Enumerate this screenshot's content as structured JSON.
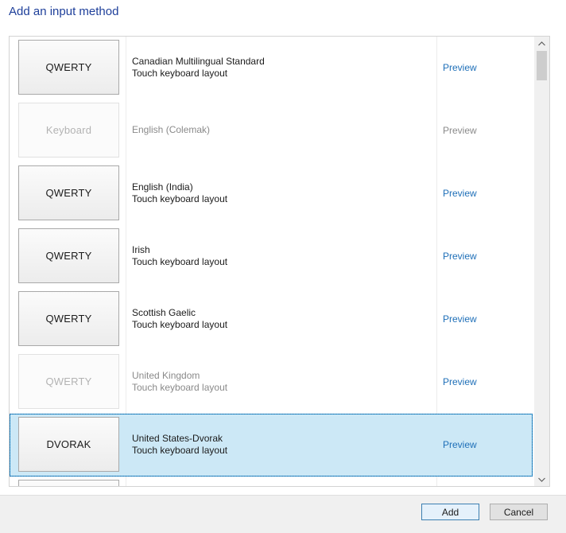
{
  "dialog": {
    "title": "Add an input method"
  },
  "list": {
    "items": [
      {
        "thumb": "QWERTY",
        "name": "Canadian Multilingual Standard",
        "subtitle": "Touch keyboard layout",
        "preview": "Preview",
        "enabled": true,
        "selected": false
      },
      {
        "thumb": "Keyboard",
        "name": "English (Colemak)",
        "subtitle": "",
        "preview": "Preview",
        "enabled": false,
        "selected": false
      },
      {
        "thumb": "QWERTY",
        "name": "English (India)",
        "subtitle": "Touch keyboard layout",
        "preview": "Preview",
        "enabled": true,
        "selected": false
      },
      {
        "thumb": "QWERTY",
        "name": "Irish",
        "subtitle": "Touch keyboard layout",
        "preview": "Preview",
        "enabled": true,
        "selected": false
      },
      {
        "thumb": "QWERTY",
        "name": "Scottish Gaelic",
        "subtitle": "Touch keyboard layout",
        "preview": "Preview",
        "enabled": true,
        "selected": false
      },
      {
        "thumb": "QWERTY",
        "name": "United Kingdom",
        "subtitle": "Touch keyboard layout",
        "preview": "Preview",
        "enabled": false,
        "selected": false
      },
      {
        "thumb": "DVORAK",
        "name": "United States-Dvorak",
        "subtitle": "Touch keyboard layout",
        "preview": "Preview",
        "enabled": true,
        "selected": true
      },
      {
        "thumb": "",
        "name": "",
        "subtitle": "",
        "preview": "",
        "enabled": true,
        "selected": false
      }
    ]
  },
  "scrollbar": {
    "up_icon": "chevron-up-icon",
    "down_icon": "chevron-down-icon"
  },
  "footer": {
    "add_label": "Add",
    "cancel_label": "Cancel"
  },
  "colors": {
    "title": "#1e3f9a",
    "link": "#1e6fb8",
    "selection": "#cce8f6",
    "selection_border": "#26a0da"
  }
}
